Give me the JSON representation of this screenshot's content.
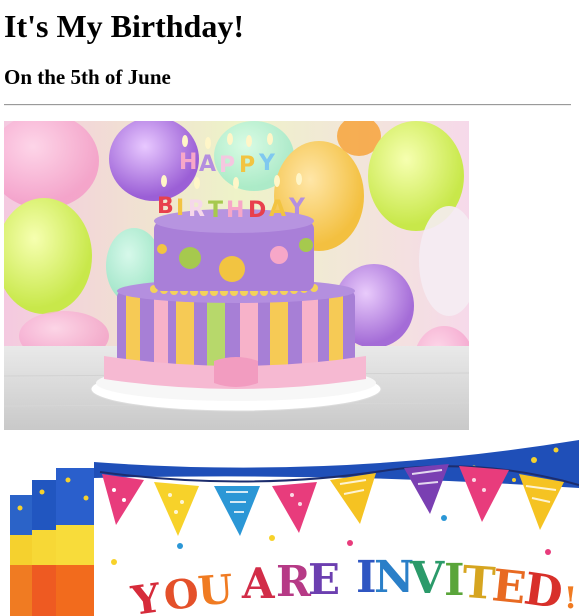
{
  "page": {
    "heading": "It's My Birthday!",
    "subheading": "On the 5th of June"
  },
  "images": {
    "cake": {
      "subject": "birthday-cake",
      "candle_lettering": "HAPPY BIRTHDAY"
    },
    "invitation": {
      "subject": "party-invitation-banner",
      "lettering": "YOU ARE INVITED"
    }
  },
  "colors": {
    "text": "#000000",
    "rule": "#9a9a9a",
    "background": "#ffffff"
  }
}
